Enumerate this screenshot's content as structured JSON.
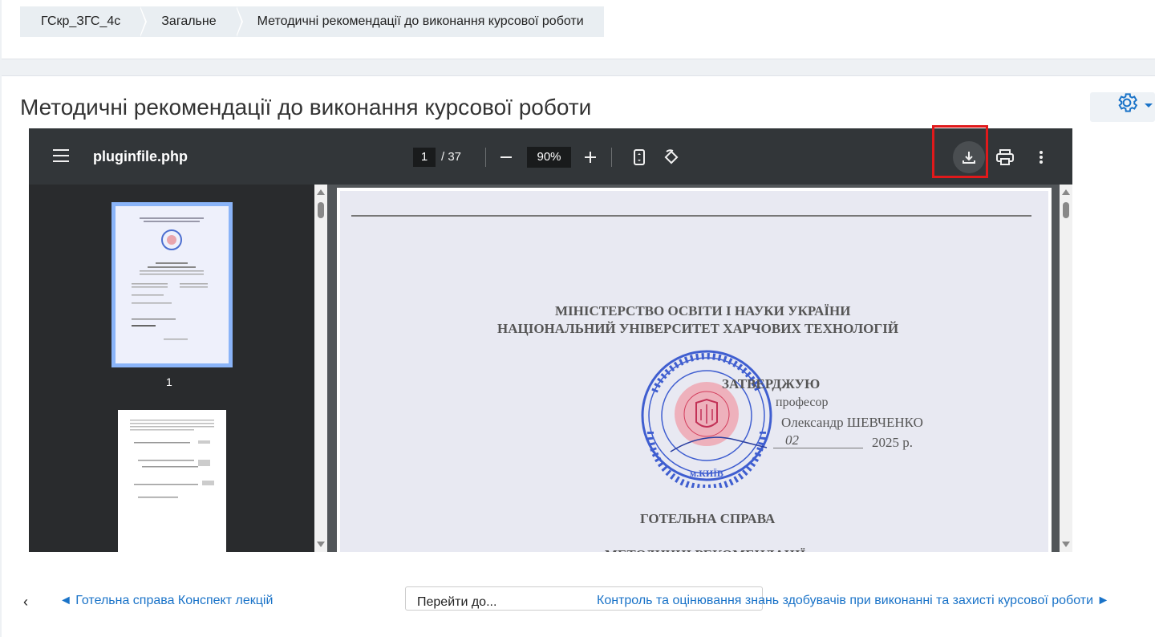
{
  "breadcrumb": {
    "items": [
      "ГСкр_ЗГС_4с",
      "Загальне",
      "Методичні рекомендації до виконання курсової роботи"
    ]
  },
  "page": {
    "title": "Методичні рекомендації до виконання курсової роботи"
  },
  "viewer": {
    "filename": "pluginfile.php",
    "current_page": "1",
    "total_pages": "/ 37",
    "zoom": "90%",
    "thumb_label": "1"
  },
  "document": {
    "ministry_line1": "МІНІСТЕРСТВО ОСВІТИ І НАУКИ УКРАЇНИ",
    "ministry_line2": "НАЦІОНАЛЬНИЙ УНІВЕРСИТЕТ ХАРЧОВИХ ТЕХНОЛОГІЙ",
    "approve": "ЗАТВЕРДЖУЮ",
    "position": "професор",
    "signer": "Олександр ШЕВЧЕНКО",
    "date_month": "02",
    "year": "2025 р.",
    "subject": "ГОТЕЛЬНА СПРАВА",
    "doc_type": "МЕТОДИЧНІ РЕКОМЕНДАЦІЇ",
    "stamp_city": "м.КИЇВ"
  },
  "nav": {
    "back_chevron": "‹",
    "prev": "◄ Готельна справа Конспект лекцій",
    "jump_placeholder": "Перейти до...",
    "next": "Контроль та оцінювання знань здобувачів при виконанні та захисті курсової роботи ►"
  },
  "colors": {
    "accent": "#1a73c8",
    "highlight": "#e0191b",
    "toolbar": "#323639"
  }
}
